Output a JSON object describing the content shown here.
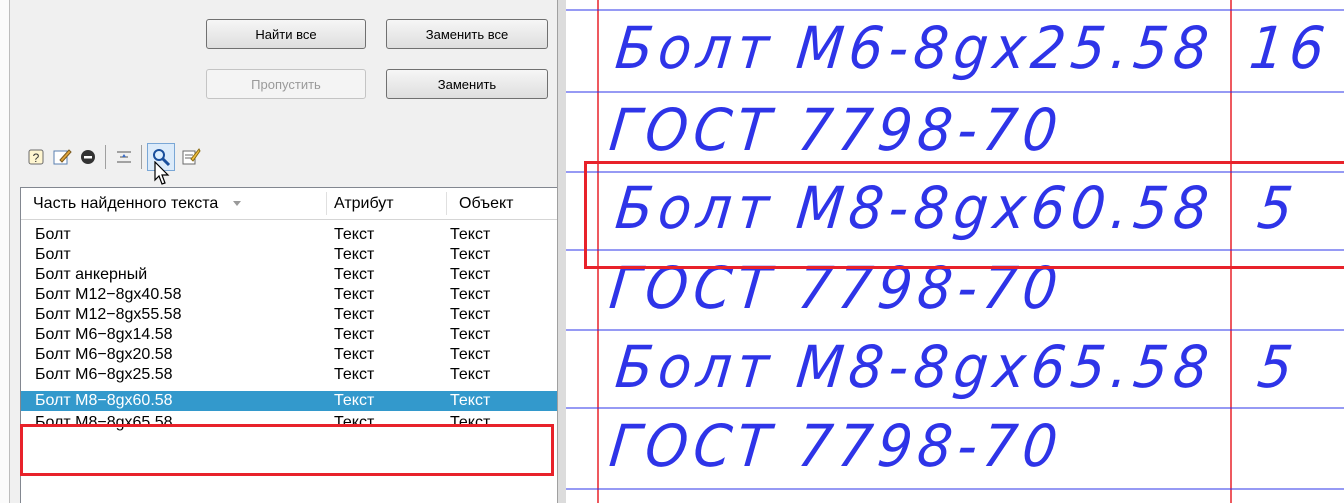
{
  "dialog": {
    "buttons": {
      "find_all": "Найти все",
      "replace_all": "Заменить все",
      "skip": "Пропустить",
      "replace": "Заменить"
    },
    "toolbar_icons": [
      "help-icon",
      "edit-icon",
      "stop-icon",
      "align-icon",
      "zoom-icon",
      "properties-icon"
    ],
    "results": {
      "columns": [
        "Часть найденного текста",
        "Атрибут",
        "Объект"
      ],
      "rows": [
        {
          "text": "Болт",
          "attr": "Текст",
          "obj": "Текст"
        },
        {
          "text": "Болт",
          "attr": "Текст",
          "obj": "Текст"
        },
        {
          "text": "Болт анкерный",
          "attr": "Текст",
          "obj": "Текст"
        },
        {
          "text": "Болт М12−8gx40.58",
          "attr": "Текст",
          "obj": "Текст"
        },
        {
          "text": "Болт М12−8gx55.58",
          "attr": "Текст",
          "obj": "Текст"
        },
        {
          "text": "Болт М6−8gx14.58",
          "attr": "Текст",
          "obj": "Текст"
        },
        {
          "text": "Болт М6−8gx20.58",
          "attr": "Текст",
          "obj": "Текст"
        },
        {
          "text": "Болт М6−8gx25.58",
          "attr": "Текст",
          "obj": "Текст"
        },
        {
          "text": "Болт М8−8gx60.58",
          "attr": "Текст",
          "obj": "Текст"
        },
        {
          "text": "Болт М8−8gx65.58",
          "attr": "Текст",
          "obj": "Текст"
        }
      ],
      "selected_index": 8
    }
  },
  "drawing": {
    "lines": [
      {
        "name": "Болт М6-8gx25.58",
        "qty": "16"
      },
      {
        "name": "ГОСТ 7798-70",
        "qty": ""
      },
      {
        "name": "Болт М8-8gx60.58",
        "qty": "5"
      },
      {
        "name": "ГОСТ 7798-70",
        "qty": ""
      },
      {
        "name": "Болт М8-8gx65.58",
        "qty": "5"
      },
      {
        "name": "ГОСТ 7798-70",
        "qty": ""
      }
    ]
  },
  "colors": {
    "cad_line": "#2e34e8",
    "cad_frame": "#e8222a",
    "highlight": "#e8222a",
    "selection": "#3399cc"
  }
}
